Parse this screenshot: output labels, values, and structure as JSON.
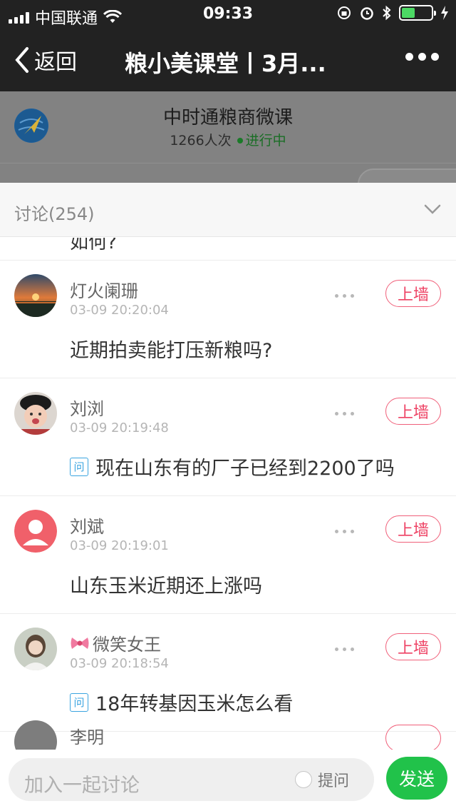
{
  "status_bar": {
    "carrier": "中国联通",
    "time": "09:33",
    "battery_level": 0.45,
    "battery_color": "#4cd964"
  },
  "nav": {
    "back_label": "返回",
    "title": "粮小美课堂丨3月...",
    "more_icon": "more-dots-icon"
  },
  "live": {
    "name": "中时通粮商微课",
    "views": "1266人次",
    "status": "进行中"
  },
  "discussion": {
    "title": "讨论(254)",
    "partial_text_top": "如何?",
    "wall_label": "上墙",
    "ask_tag": "问",
    "items": [
      {
        "name": "灯火阑珊",
        "time": "03-09 20:20:04",
        "content": "近期拍卖能打压新粮吗?",
        "is_question": false,
        "avatar": "sunset-avatar"
      },
      {
        "name": "刘浏",
        "time": "03-09 20:19:48",
        "content": "现在山东有的厂子已经到2200了吗",
        "is_question": true,
        "avatar": "baby-photo-avatar"
      },
      {
        "name": "刘斌",
        "time": "03-09 20:19:01",
        "content": "山东玉米近期还上涨吗",
        "is_question": false,
        "avatar": "default-user-avatar"
      },
      {
        "name": "微笑女王",
        "name_prefix_icon": "bow-emoji-icon",
        "time": "03-09 20:18:54",
        "content": "18年转基因玉米怎么看",
        "is_question": true,
        "avatar": "woman-photo-avatar"
      }
    ],
    "partial_bottom_name": "李明"
  },
  "composer": {
    "placeholder": "加入一起讨论",
    "ask_label": "提问",
    "send_label": "发送",
    "send_color": "#21c24a"
  },
  "colors": {
    "nav_bg": "#222222",
    "wall_red": "#ee4163",
    "ask_blue": "#3aa4e0"
  }
}
